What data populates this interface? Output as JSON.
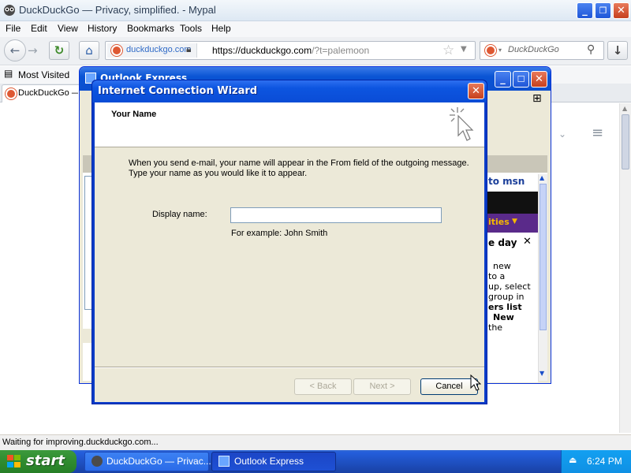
{
  "browser": {
    "title": "DuckDuckGo — Privacy, simplified. - Mypal",
    "menu": [
      "File",
      "Edit",
      "View",
      "History",
      "Bookmarks",
      "Tools",
      "Help"
    ],
    "menu_underline": [
      "F",
      "E",
      "V",
      "H",
      "B",
      "T",
      "H"
    ],
    "url": {
      "identity": "duckduckgo.com",
      "scheme_host": "https://duckduckgo.com",
      "path": "/?t=palemoon"
    },
    "search_placeholder": "DuckDuckGo",
    "bookmarks": [
      "Most Visited"
    ],
    "tab_label": "DuckDuckGo — Privacy, simplified.",
    "status_text": "Waiting for improving.duckduckgo.com..."
  },
  "outlook": {
    "title": "Outlook Express",
    "msn_text": "to msn",
    "partial_lines": [
      "ities",
      "e day",
      "new",
      "to a",
      "up, select",
      "group in",
      "ers list",
      "New",
      "the"
    ]
  },
  "wizard": {
    "title": "Internet Connection Wizard",
    "heading": "Your Name",
    "instruction_line1": "When you send e-mail, your name will appear in the From field of the outgoing message.",
    "instruction_line2": "Type your name as you would like it to appear.",
    "display_name_label": "Display name:",
    "display_name_value": "",
    "example": "For example: John Smith",
    "back_label": "< Back",
    "next_label": "Next >",
    "cancel_label": "Cancel"
  },
  "taskbar": {
    "start_label": "start",
    "tasks": [
      "DuckDuckGo — Privac...",
      "Outlook Express"
    ],
    "clock": "6:24 PM"
  },
  "colors": {
    "xp_blue": "#0a4cd6",
    "start_green": "#2f8b2f",
    "ddg_orange": "#de5833",
    "close_red": "#c6401e"
  }
}
